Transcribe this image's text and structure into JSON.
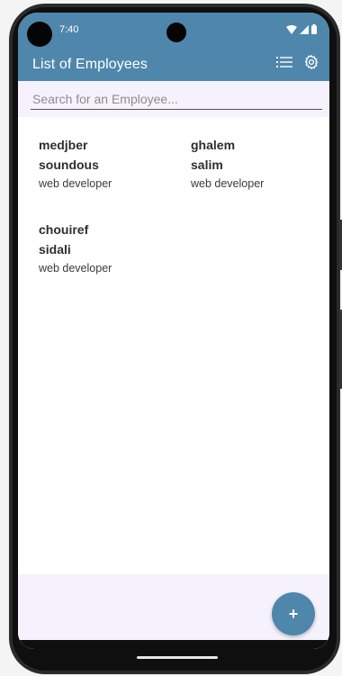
{
  "status_bar": {
    "time": "7:40"
  },
  "app_bar": {
    "title": "List of Employees",
    "color": "#4f86ab",
    "actions": [
      "list-icon",
      "settings-icon"
    ]
  },
  "search": {
    "placeholder": "Search for an Employee...",
    "value": ""
  },
  "employees": [
    {
      "first_name": "medjber",
      "last_name": "soundous",
      "role": "web developer"
    },
    {
      "first_name": "ghalem",
      "last_name": "salim",
      "role": "web developer"
    },
    {
      "first_name": "chouiref",
      "last_name": "sidali",
      "role": "web developer"
    }
  ],
  "fab": {
    "label": "+",
    "icon": "add-icon"
  }
}
